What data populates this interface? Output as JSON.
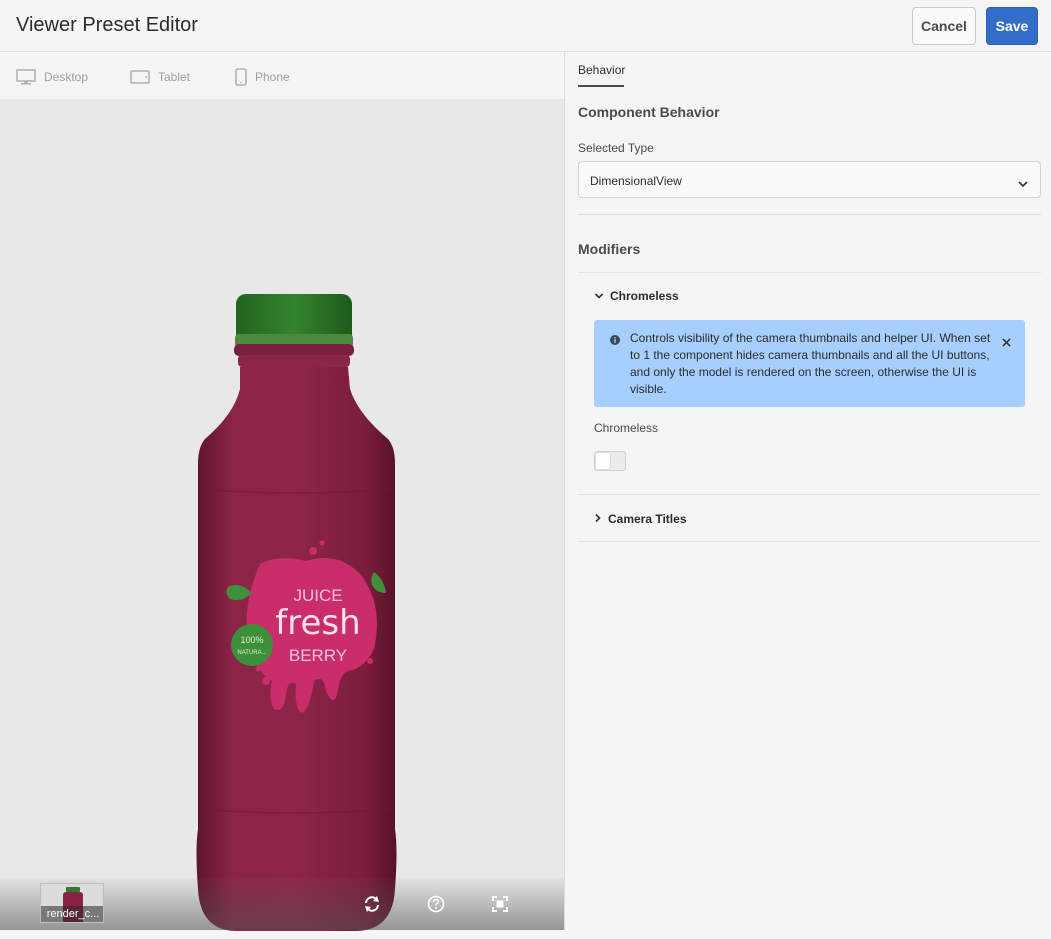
{
  "header": {
    "title": "Viewer Preset Editor",
    "cancel_label": "Cancel",
    "save_label": "Save"
  },
  "devices": [
    {
      "label": "Desktop",
      "icon": "desktop-icon"
    },
    {
      "label": "Tablet",
      "icon": "tablet-icon"
    },
    {
      "label": "Phone",
      "icon": "phone-icon"
    }
  ],
  "viewer": {
    "product": {
      "label_line1": "JUICE",
      "label_line2": "fresh",
      "label_line3": "BERRY",
      "badge_line1": "100%",
      "badge_line2": "NATURA..."
    },
    "thumbnail_label": "render_c...",
    "controls": [
      "reset-icon",
      "help-icon",
      "fullscreen-icon"
    ]
  },
  "panel": {
    "tab_label": "Behavior",
    "component_heading": "Component Behavior",
    "selected_type_label": "Selected Type",
    "selected_type_value": "DimensionalView",
    "modifiers_heading": "Modifiers",
    "chromeless_section": {
      "title": "Chromeless",
      "expanded": true,
      "info_text": "Controls visibility of the camera thumbnails and helper UI. When set to 1 the component hides camera thumbnails and all the UI buttons, and only the model is rendered on the screen, otherwise the UI is visible.",
      "field_label": "Chromeless",
      "toggle_on": false
    },
    "camera_titles_section": {
      "title": "Camera Titles",
      "expanded": false
    }
  },
  "colors": {
    "accent": "#326ec8",
    "info_background": "#a6cefe",
    "bottle_body": "#8a2245",
    "cap": "#2f7d2a",
    "label_splash": "#c9306b"
  }
}
